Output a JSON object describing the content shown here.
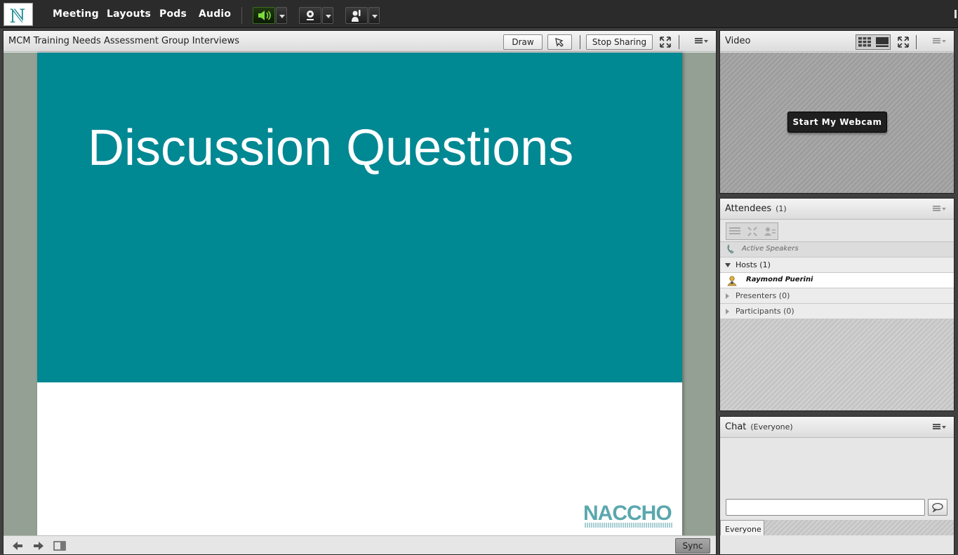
{
  "menu": {
    "meeting": "Meeting",
    "layouts": "Layouts",
    "pods": "Pods",
    "audio": "Audio"
  },
  "share_pod": {
    "title": "MCM Training Needs Assessment Group Interviews",
    "draw_label": "Draw",
    "stop_sharing_label": "Stop Sharing",
    "sync_label": "Sync",
    "slide_title": "Discussion Questions",
    "slide_logo": "NACCHO"
  },
  "video_pod": {
    "title": "Video",
    "start_webcam_label": "Start My Webcam"
  },
  "attendees_pod": {
    "title": "Attendees",
    "count": "(1)",
    "active_speakers": "Active Speakers",
    "hosts": "Hosts (1)",
    "host_name": "Raymond  Puerini",
    "presenters": "Presenters (0)",
    "participants": "Participants (0)"
  },
  "chat_pod": {
    "title": "Chat",
    "scope": "(Everyone)",
    "tab": "Everyone"
  },
  "colors": {
    "slide_teal": "#008893",
    "audio_active": "#7ddc3b"
  }
}
